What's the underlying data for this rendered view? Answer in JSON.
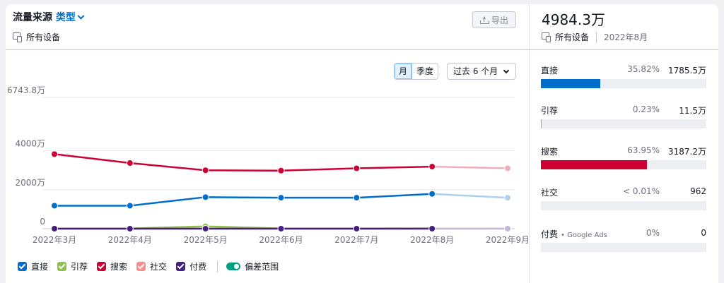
{
  "header": {
    "title": "流量来源",
    "title_link": "类型",
    "device": "所有设备",
    "export_label": "导出"
  },
  "controls": {
    "granularity": [
      "月",
      "季度"
    ],
    "granularity_active": 0,
    "period": "过去 6 个月"
  },
  "chart_data": {
    "type": "line",
    "x": [
      "2022年3月",
      "2022年4月",
      "2022年5月",
      "2022年6月",
      "2022年7月",
      "2022年8月",
      "2022年9月"
    ],
    "y_ticks": [
      "6743.8万",
      "4000万",
      "2000万",
      "0"
    ],
    "y_tick_values": [
      6743.8,
      4000,
      2000,
      0
    ],
    "ylim": [
      0,
      6743.8
    ],
    "y_unit": "万",
    "projected_from_index": 5,
    "grid": true,
    "series": [
      {
        "name": "引荐",
        "color": "#8bc34a",
        "values": [
          11,
          11,
          120,
          11,
          11,
          11.5,
          11
        ]
      },
      {
        "name": "直接",
        "color": "#006dca",
        "values": [
          1180,
          1180,
          1620,
          1590,
          1590,
          1785.5,
          1590
        ]
      },
      {
        "name": "搜索",
        "color": "#cc0033",
        "values": [
          3830,
          3370,
          3000,
          2980,
          3100,
          3187.2,
          3100
        ]
      },
      {
        "name": "社交",
        "color": "#ff8c8c",
        "values": [
          0.1,
          0.1,
          0.1,
          0.1,
          0.1,
          0.1,
          0.1
        ]
      },
      {
        "name": "付费",
        "color": "#44207e",
        "values": [
          0,
          0,
          0,
          0,
          0,
          0,
          0
        ]
      }
    ],
    "legend": [
      {
        "name": "直接",
        "color": "#006dca"
      },
      {
        "name": "引荐",
        "color": "#8bc34a"
      },
      {
        "name": "搜索",
        "color": "#cc0033"
      },
      {
        "name": "社交",
        "color": "#ff8c8c"
      },
      {
        "name": "付费",
        "color": "#44207e"
      }
    ],
    "legend_toggle": "偏差范围",
    "legend_placement": "bottom"
  },
  "summary": {
    "total": "4984.3万",
    "device": "所有设备",
    "date": "2022年8月",
    "sources": [
      {
        "label": "直接",
        "sub": "",
        "pct": "35.82%",
        "value": "1785.5万",
        "share": 0.3582,
        "color": "#006dca"
      },
      {
        "label": "引荐",
        "sub": "",
        "pct": "0.23%",
        "value": "11.5万",
        "share": 0.0023,
        "color": "#8bc34a"
      },
      {
        "label": "搜索",
        "sub": "",
        "pct": "63.95%",
        "value": "3187.2万",
        "share": 0.6395,
        "color": "#cc0033"
      },
      {
        "label": "社交",
        "sub": "",
        "pct": "< 0.01%",
        "value": "962",
        "share": 0.0,
        "color": "#ff8c8c"
      },
      {
        "label": "付费",
        "sub": "Google Ads",
        "pct": "0%",
        "value": "0",
        "share": 0.0,
        "color": "#44207e"
      }
    ]
  }
}
